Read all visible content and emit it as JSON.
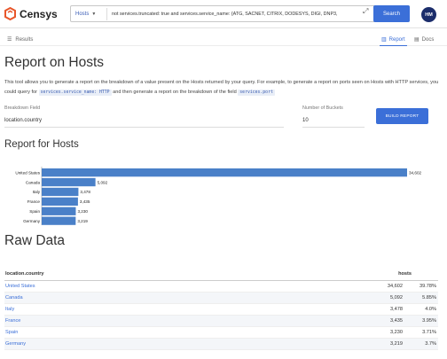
{
  "app": {
    "name": "Censys"
  },
  "search": {
    "scope": "Hosts",
    "query": "not services.truncated: true and services.service_name: {ATG, SACNET, CITRIX, DODESYS, DIGI, DNP3, ",
    "button_label": "Search"
  },
  "user": {
    "initials": "HM"
  },
  "subnav": {
    "results_label": "Results",
    "report_tab": "Report",
    "docs_tab": "Docs"
  },
  "page": {
    "title": "Report on Hosts",
    "description_part1": "This tool allows you to generate a report on the breakdown of a value present on the Hosts returned by your query. For example, to generate a report on ports seen on Hosts with HTTP services, you could query for ",
    "code1": "services.service_name: HTTP",
    "description_part2": " and then generate a report on the breakdown of the field ",
    "code2": "services.port"
  },
  "form": {
    "field_label": "Breakdown Field",
    "field_value": "location.country",
    "buckets_label": "Number of Buckets",
    "buckets_value": "10",
    "build_button": "BUILD REPORT"
  },
  "report_section": {
    "title": "Report for Hosts"
  },
  "chart_data": {
    "type": "bar",
    "orientation": "horizontal",
    "categories": [
      "United States",
      "Canada",
      "Italy",
      "France",
      "Spain",
      "Germany"
    ],
    "values": [
      34602,
      5092,
      3478,
      3435,
      3230,
      3219
    ],
    "value_labels": [
      "34,602",
      "5,092",
      "3,478",
      "3,435",
      "3,230",
      "3,219"
    ],
    "bar_color": "#4a80c8"
  },
  "raw_data": {
    "title": "Raw Data",
    "columns": [
      "location.country",
      "hosts"
    ],
    "rows": [
      {
        "country": "United States",
        "count": "34,602",
        "pct": "39.78%"
      },
      {
        "country": "Canada",
        "count": "5,092",
        "pct": "5.85%"
      },
      {
        "country": "Italy",
        "count": "3,478",
        "pct": "4.0%"
      },
      {
        "country": "France",
        "count": "3,435",
        "pct": "3.95%"
      },
      {
        "country": "Spain",
        "count": "3,230",
        "pct": "3.71%"
      },
      {
        "country": "Germany",
        "count": "3,219",
        "pct": "3.7%"
      }
    ]
  },
  "colors": {
    "accent": "#3b6fd8",
    "avatar": "#1b2d6b"
  }
}
